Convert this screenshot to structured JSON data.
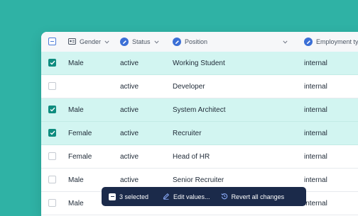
{
  "columns": {
    "gender": "Gender",
    "status": "Status",
    "position": "Position",
    "employment": "Employment ty"
  },
  "rows": [
    {
      "selected": true,
      "gender": "Male",
      "status": "active",
      "position": "Working Student",
      "employment": "internal"
    },
    {
      "selected": false,
      "gender": "",
      "status": "active",
      "position": "Developer",
      "employment": "internal"
    },
    {
      "selected": true,
      "gender": "Male",
      "status": "active",
      "position": "System Architect",
      "employment": "internal"
    },
    {
      "selected": true,
      "gender": "Female",
      "status": "active",
      "position": "Recruiter",
      "employment": "internal"
    },
    {
      "selected": false,
      "gender": "Female",
      "status": "active",
      "position": "Head of HR",
      "employment": "internal"
    },
    {
      "selected": false,
      "gender": "Male",
      "status": "active",
      "position": "Senior Recruiter",
      "employment": "internal"
    },
    {
      "selected": false,
      "gender": "Male",
      "status": "",
      "position": "",
      "employment": "internal"
    }
  ],
  "toolbar": {
    "selected_label": "3 selected",
    "edit_label": "Edit values...",
    "revert_label": "Revert all changes"
  },
  "colors": {
    "background": "#2fb2a5",
    "selected_row": "#d2f5f1",
    "toolbar": "#1b2a4a",
    "accent": "#3b6fd6"
  }
}
